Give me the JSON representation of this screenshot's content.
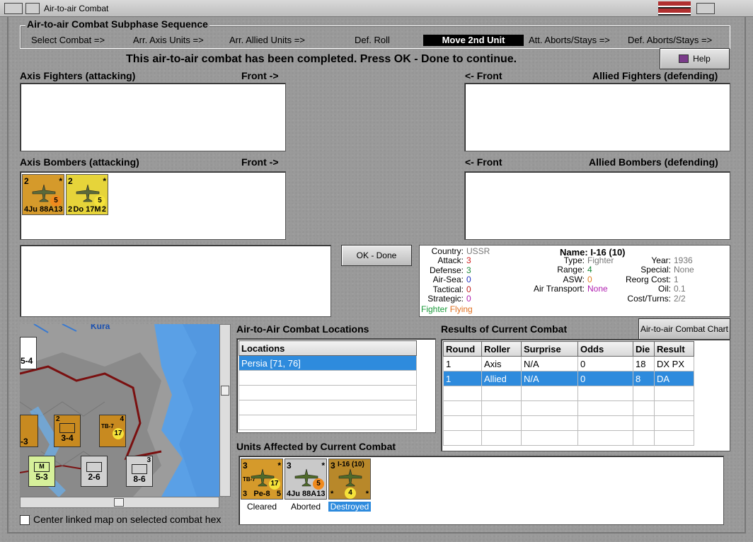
{
  "window": {
    "title": "Air-to-air Combat"
  },
  "sequence": {
    "title": "Air-to-air Combat Subphase Sequence",
    "steps": [
      "Select Combat =>",
      "Arr. Axis Units =>",
      "Arr. Allied Units  =>",
      "Def. Roll",
      "Move 2nd Unit",
      "Att. Aborts/Stays =>",
      "Def. Aborts/Stays =>"
    ],
    "active_index": 4
  },
  "status_message": "This air-to-air combat has been completed.  Press OK - Done to continue.",
  "help_label": "Help",
  "panels": {
    "axis_fighters": {
      "label": "Axis Fighters (attacking)",
      "front": "Front ->"
    },
    "allied_fighters": {
      "label": "Allied Fighters (defending)",
      "front": "<- Front"
    },
    "axis_bombers": {
      "label": "Axis Bombers (attacking)",
      "front": "Front ->"
    },
    "allied_bombers": {
      "label": "Allied Bombers (defending)",
      "front": "<- Front"
    }
  },
  "axis_bomber_counters": [
    {
      "top_left": "2",
      "top_right": "*",
      "bottom_left": "4",
      "name": "Ju 88A1",
      "bottom_right": "3",
      "range": "5",
      "color": "#d59a2b"
    },
    {
      "top_left": "2",
      "top_right": "*",
      "bottom_left": "2",
      "name": "Do 17M",
      "bottom_right": "2",
      "range": "5",
      "color": "#e6d43a"
    }
  ],
  "ok_button": "OK - Done",
  "unit_info": {
    "left": [
      {
        "key": "Country:",
        "value": "USSR",
        "color": "#777777"
      },
      {
        "key": "Attack:",
        "value": "3",
        "color": "#d02020"
      },
      {
        "key": "Defense:",
        "value": "3",
        "color": "#1a8a3a"
      },
      {
        "key": "Air-Sea:",
        "value": "0",
        "color": "#2030c0"
      },
      {
        "key": "Tactical:",
        "value": "0",
        "color": "#c02020"
      },
      {
        "key": "Strategic:",
        "value": "0",
        "color": "#b020b0"
      }
    ],
    "tag_fighter": "Fighter",
    "tag_flying": "Flying",
    "name_key": "Name:",
    "name_value": "I-16 (10)",
    "middle": [
      {
        "key": "Type:",
        "value": "Fighter",
        "color": "#777777"
      },
      {
        "key": "Range:",
        "value": "4",
        "color": "#1a8a3a"
      },
      {
        "key": "ASW:",
        "value": "0",
        "color": "#e08020"
      },
      {
        "key": "Air Transport:",
        "value": "None",
        "color": "#b020b0"
      }
    ],
    "right": [
      {
        "key": "Year:",
        "value": "1936",
        "color": "#777777"
      },
      {
        "key": "Special:",
        "value": "None",
        "color": "#777777"
      },
      {
        "key": "Reorg Cost:",
        "value": "1",
        "color": "#777777"
      },
      {
        "key": "Oil:",
        "value": "0.1",
        "color": "#777777"
      },
      {
        "key": "Cost/Turns:",
        "value": "2/2",
        "color": "#777777"
      }
    ]
  },
  "map": {
    "river_label": "Kura",
    "units": [
      {
        "top": "2",
        "value": "3-4",
        "label": "xxx"
      },
      {
        "top": "4",
        "value": "17",
        "label": "TB-7"
      },
      {
        "top": "",
        "value": "5-3",
        "label": "xxx"
      },
      {
        "top": "",
        "value": "2-6",
        "label": "xx"
      },
      {
        "top": "3",
        "value": "8-6",
        "label": "xxx"
      }
    ],
    "edge_values": [
      "5-4",
      "-3"
    ],
    "center_checkbox_label": "Center linked map on selected combat hex"
  },
  "locations": {
    "title": "Air-to-Air Combat Locations",
    "header": "Locations",
    "rows": [
      "Persia [71, 76]"
    ]
  },
  "results": {
    "title": "Results of Current Combat",
    "chart_button": "Air-to-air Combat Chart",
    "columns": [
      "Round",
      "Roller",
      "Surprise",
      "Odds",
      "Die",
      "Result"
    ],
    "rows": [
      [
        "1",
        "Axis",
        "N/A",
        "0",
        "18",
        "DX PX"
      ],
      [
        "1",
        "Allied",
        "N/A",
        "0",
        "8",
        "DA"
      ]
    ],
    "selected_row": 1
  },
  "affected": {
    "title": "Units Affected by Current Combat",
    "units": [
      {
        "top_left": "3",
        "top_right": "*",
        "name": "Pe-8",
        "bottom_left": "3",
        "bottom_right": "5",
        "range": "17",
        "sub": "TB-7",
        "status": "Cleared",
        "color": "#d59a2b"
      },
      {
        "top_left": "3",
        "top_right": "*",
        "name": "Ju 88A1",
        "bottom_left": "4",
        "bottom_right": "3",
        "range": "5",
        "sub": "",
        "status": "Aborted",
        "color": "#c9c9c9"
      },
      {
        "top_left": "3",
        "top_right": "",
        "name": "I-16 (10)",
        "bottom_left": "*",
        "bottom_right": "*",
        "range": "4",
        "sub": "",
        "status": "Destroyed",
        "color": "#b8882a"
      }
    ]
  }
}
